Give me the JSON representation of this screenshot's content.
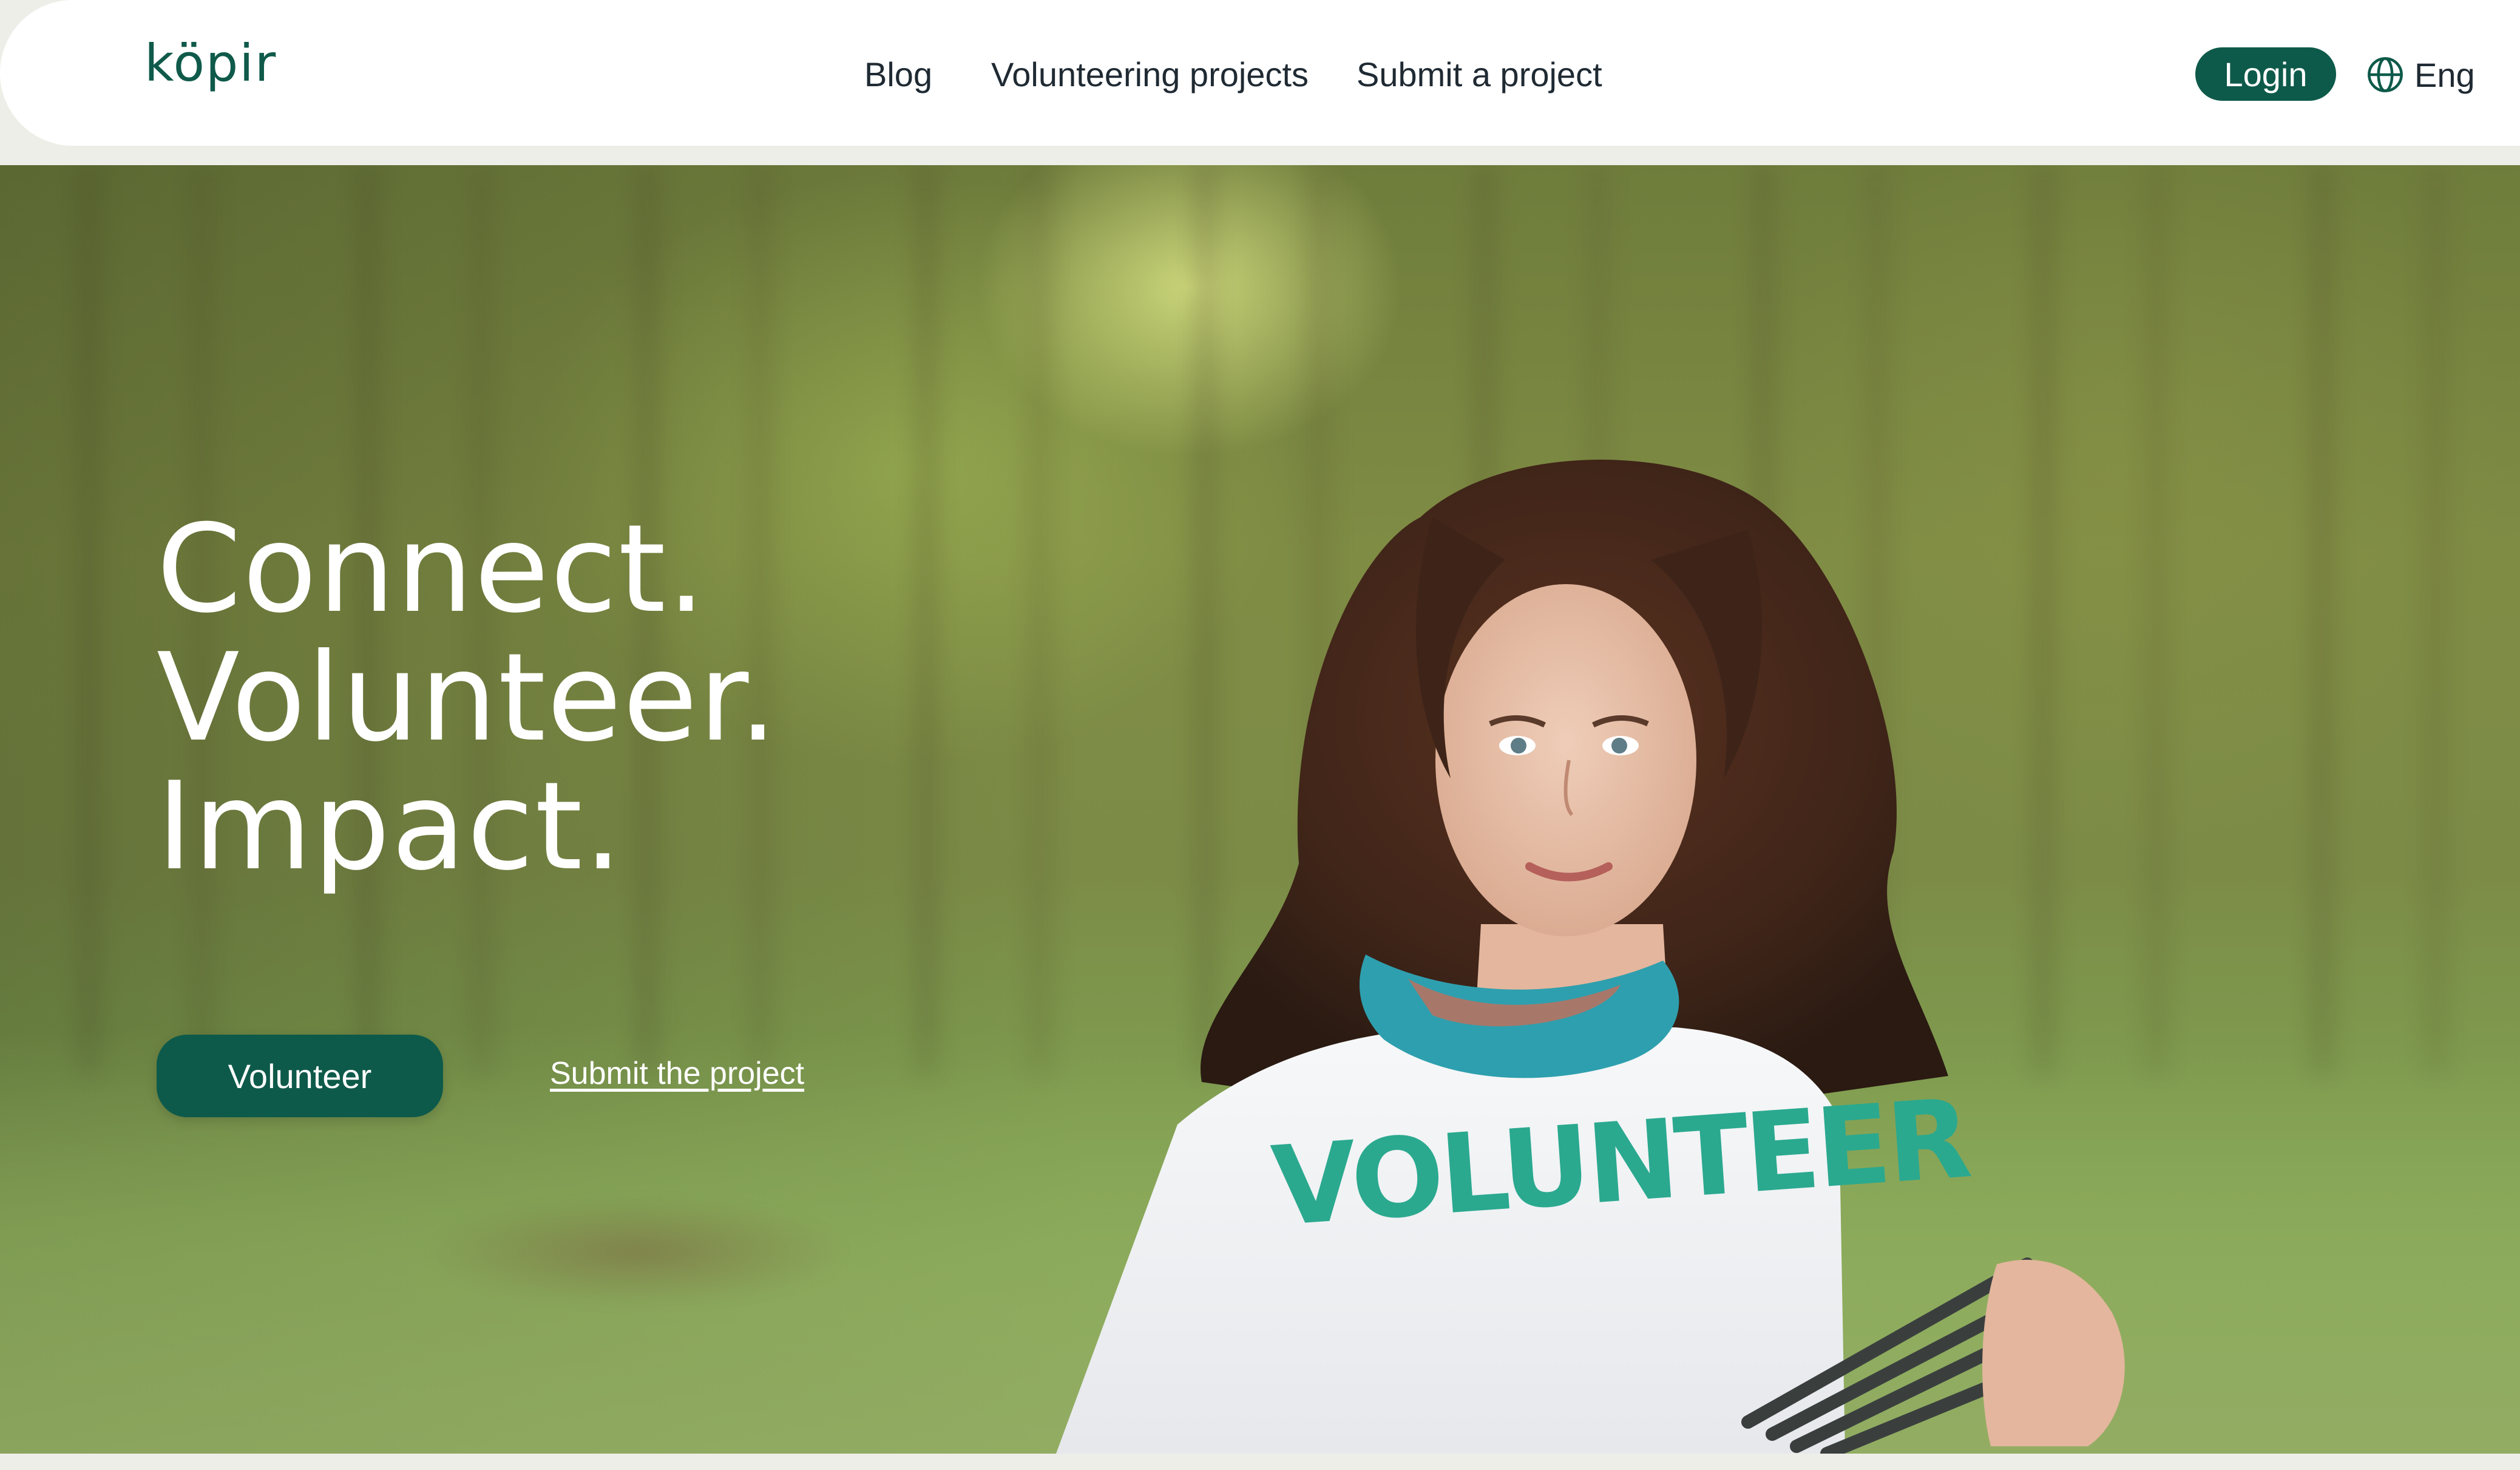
{
  "header": {
    "logo": "köpir",
    "nav": [
      {
        "label": "Blog"
      },
      {
        "label": "Volunteering projects"
      },
      {
        "label": "Submit a project"
      }
    ],
    "login_label": "Login",
    "language_label": "Eng",
    "language_icon": "globe-icon"
  },
  "hero": {
    "headline_lines": [
      "Connect.",
      "Volunteer.",
      "Impact."
    ],
    "primary_cta": "Volunteer",
    "secondary_cta": "Submit the project",
    "shirt_text": "VOLUNTEER",
    "image_description_icon": "hero-photo"
  },
  "colors": {
    "brand": "#0e5a4a",
    "header_bg": "#ffffff",
    "page_bg": "#eeeee8",
    "shirt_text": "#2aa98f"
  }
}
